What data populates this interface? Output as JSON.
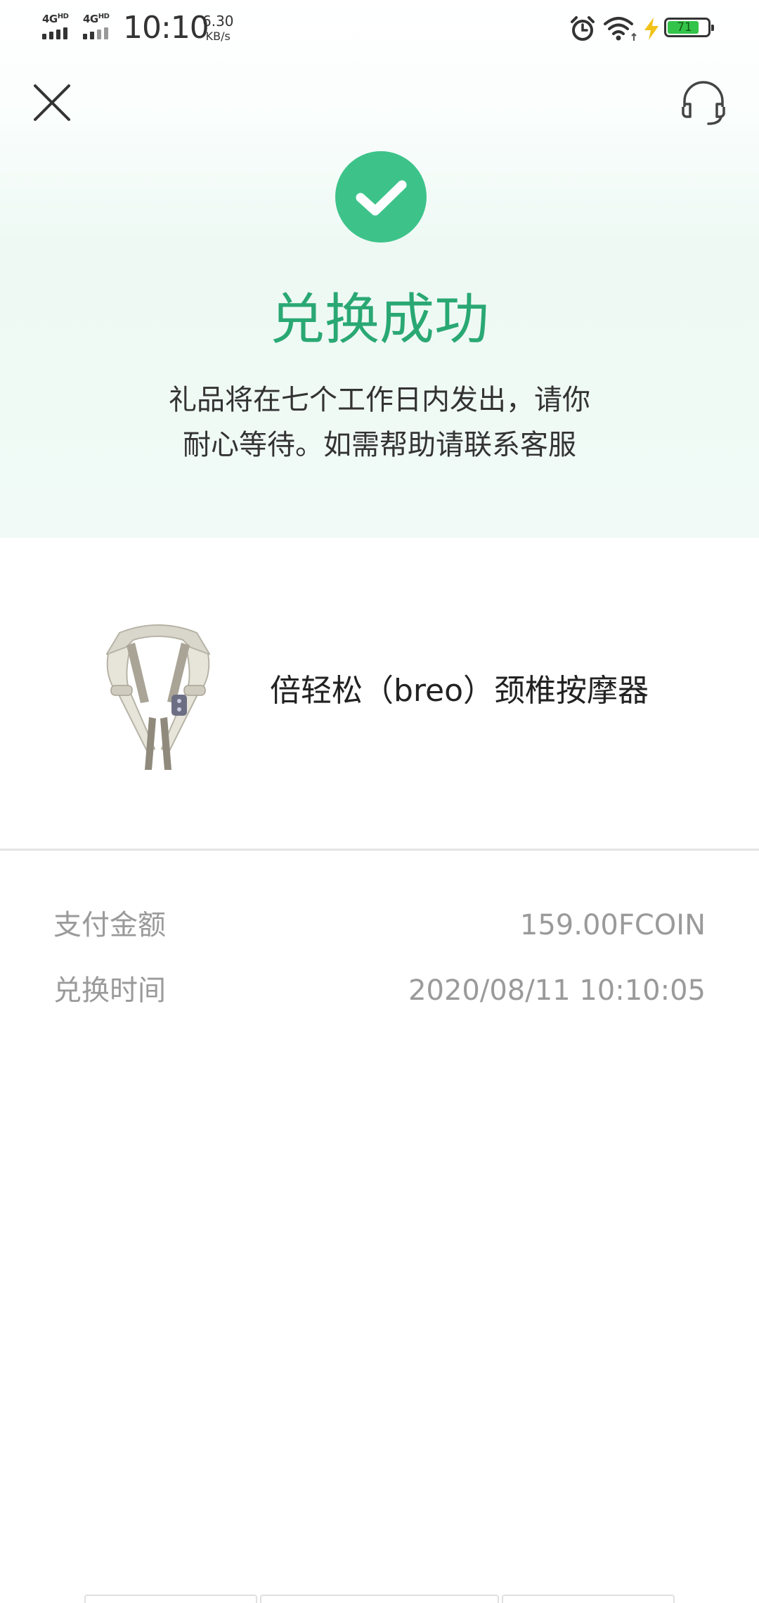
{
  "status_bar": {
    "sim1": "4G",
    "sim2": "4G",
    "time": "10:10",
    "net_speed": "6.30",
    "net_speed_unit": "KB/s",
    "battery": "71"
  },
  "header": {
    "close_icon": "close-icon",
    "service_icon": "headset-icon"
  },
  "result": {
    "icon": "check-circle-icon",
    "accent_color": "#3dc38a",
    "title": "兑换成功",
    "description_line1": "礼品将在七个工作日内发出，请你",
    "description_line2": "耐心等待。如需帮助请联系客服"
  },
  "product": {
    "name": "倍轻松（breo）颈椎按摩器",
    "image": "neck-massager-image"
  },
  "details": [
    {
      "label": "支付金额",
      "value": "159.00FCOIN"
    },
    {
      "label": "兑换时间",
      "value": "2020/08/11 10:10:05"
    }
  ]
}
